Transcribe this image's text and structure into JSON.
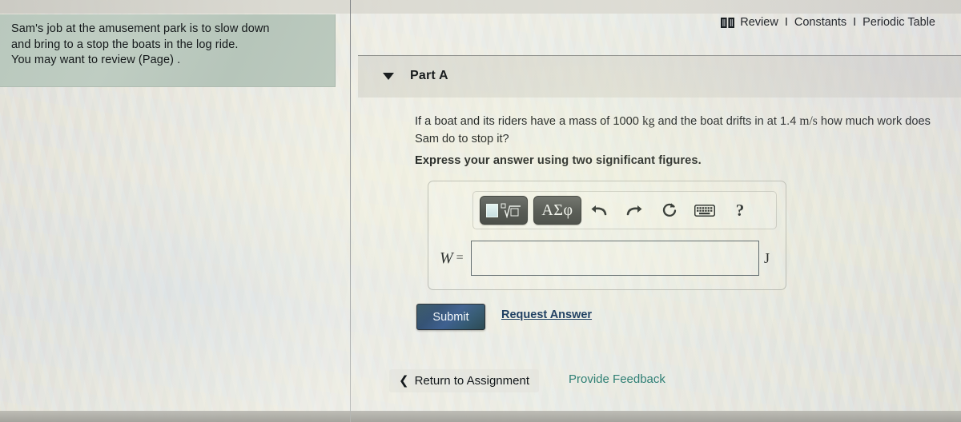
{
  "problem": {
    "line1": "Sam's job at the amusement park is to slow down",
    "line2": "and bring to a stop the boats in the log ride.",
    "line3": "You may want to review (Page) ."
  },
  "header": {
    "book_icon": "book-icon",
    "review_label": "Review",
    "sep1": "I",
    "constants_label": "Constants",
    "sep2": "I",
    "periodic_table_label": "Periodic Table"
  },
  "part": {
    "caret_icon": "chevron-down-icon",
    "title": "Part A"
  },
  "question": {
    "seg1": "If a boat and its riders have a mass of 1000",
    "unit_mass": "kg",
    "seg2": "and the boat drifts in at 1.4",
    "unit_speed": "m/s",
    "seg3": "how much work does Sam do to stop it?",
    "instruction": "Express your answer using two significant figures."
  },
  "toolbar": {
    "template_button": "template-math-button",
    "greek_button_label": "ΑΣφ",
    "undo_icon": "undo-arrow-icon",
    "redo_icon": "redo-arrow-icon",
    "reset_icon": "reset-circle-icon",
    "keyboard_icon": "keyboard-icon",
    "help_label": "?"
  },
  "answer": {
    "variable": "W",
    "equals": "=",
    "value": "",
    "placeholder": "",
    "unit": "J"
  },
  "actions": {
    "submit_label": "Submit",
    "request_answer_label": "Request Answer"
  },
  "footer": {
    "back_icon": "chevron-left-icon",
    "back_chevron": "❮",
    "return_label": "Return to Assignment",
    "feedback_label": "Provide Feedback"
  },
  "colors": {
    "problem_card_bg": "#bcc9be",
    "submit_bg": "#2f5580",
    "link_blue": "#14365c",
    "feedback_teal": "#2f7f74"
  }
}
